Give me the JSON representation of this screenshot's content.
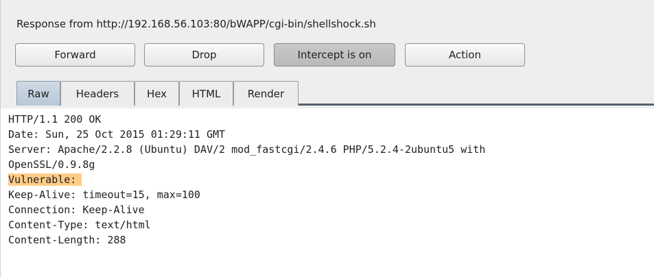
{
  "response_label": "Response from http://192.168.56.103:80/bWAPP/cgi-bin/shellshock.sh",
  "buttons": {
    "forward": "Forward",
    "drop": "Drop",
    "intercept": "Intercept is on",
    "action": "Action"
  },
  "tabs": {
    "raw": "Raw",
    "headers": "Headers",
    "hex": "Hex",
    "html": "HTML",
    "render": "Render"
  },
  "response_lines": [
    "HTTP/1.1 200 OK",
    "Date: Sun, 25 Oct 2015 01:29:11 GMT",
    "Server: Apache/2.2.8 (Ubuntu) DAV/2 mod_fastcgi/2.4.6 PHP/5.2.4-2ubuntu5 with",
    "OpenSSL/0.9.8g",
    "Vulnerable:",
    "Keep-Alive: timeout=15, max=100",
    "Connection: Keep-Alive",
    "Content-Type: text/html",
    "Content-Length: 288"
  ],
  "colors": {
    "highlight": "#ffcc88",
    "active_tab": "#b7c8d6",
    "intercept_on": "#b9b9b9"
  }
}
